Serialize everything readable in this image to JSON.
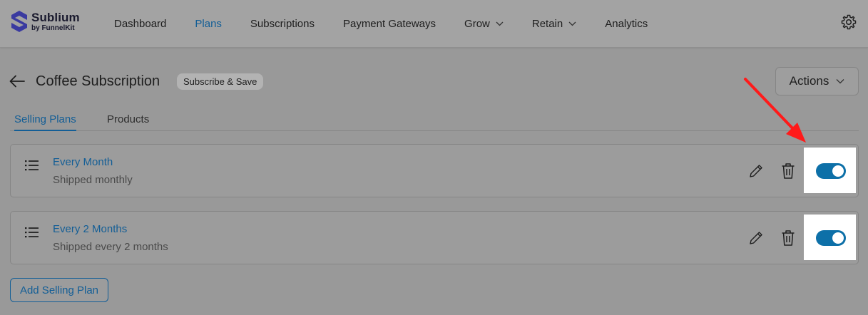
{
  "brand": {
    "name": "Sublium",
    "by_prefix": "by",
    "by_name": "FunnelKit",
    "logo_color": "#3a3aa0"
  },
  "nav": {
    "items": [
      {
        "label": "Dashboard",
        "active": false,
        "dropdown": false
      },
      {
        "label": "Plans",
        "active": true,
        "dropdown": false
      },
      {
        "label": "Subscriptions",
        "active": false,
        "dropdown": false
      },
      {
        "label": "Payment Gateways",
        "active": false,
        "dropdown": false
      },
      {
        "label": "Grow",
        "active": false,
        "dropdown": true
      },
      {
        "label": "Retain",
        "active": false,
        "dropdown": true
      },
      {
        "label": "Analytics",
        "active": false,
        "dropdown": false
      }
    ],
    "settings_icon": "gear-icon"
  },
  "header": {
    "title": "Coffee Subscription",
    "badge": "Subscribe & Save",
    "actions_label": "Actions"
  },
  "tabs": [
    {
      "label": "Selling Plans",
      "active": true
    },
    {
      "label": "Products",
      "active": false
    }
  ],
  "plans": [
    {
      "title": "Every Month",
      "subtitle": "Shipped monthly",
      "enabled": true
    },
    {
      "title": "Every 2 Months",
      "subtitle": "Shipped every 2 months",
      "enabled": true
    }
  ],
  "add_button": "Add Selling Plan",
  "colors": {
    "accent": "#135e96",
    "toggle_on": "#0d70a8",
    "annotation_arrow": "#ff1a1a",
    "overlay_background": "#999999"
  }
}
